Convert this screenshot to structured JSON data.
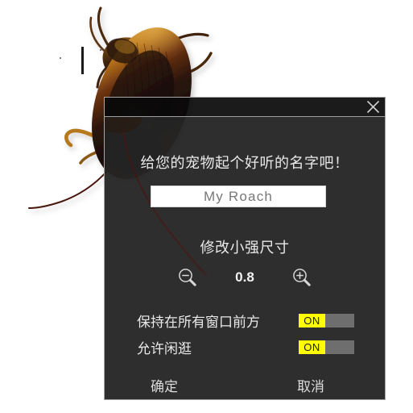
{
  "window": {
    "close_icon": "close-x-icon"
  },
  "dialog": {
    "name_heading": "给您的宠物起个好听的名字吧！",
    "name_input_value": "My Roach",
    "name_input_placeholder": "My Roach",
    "size_heading": "修改小强尺寸",
    "size_value": "0.8",
    "zoom_out_icon": "magnifier-minus-icon",
    "zoom_in_icon": "magnifier-plus-icon",
    "toggles": [
      {
        "label": "保持在所有窗口前方",
        "state": "ON"
      },
      {
        "label": "允许闲逛",
        "state": "ON"
      }
    ],
    "ok_label": "确定",
    "cancel_label": "取消"
  },
  "desktop": {
    "pet_icon": "cockroach-illustration"
  },
  "colors": {
    "dialog_bg": "#252525",
    "titlebar_bg": "#0a0a0a",
    "border": "#a8a8a8",
    "text": "#e9e9e9",
    "toggle_on": "#ffff00",
    "toggle_track": "#6e6e6e",
    "input_bg": "#ffffff",
    "input_text": "#787878",
    "roach_body_dark": "#1a100a",
    "roach_body_amber": "#c98a21",
    "roach_body_red": "#8e1f0d",
    "roach_leg": "#b5791f",
    "roach_antenna": "#4a1510"
  }
}
